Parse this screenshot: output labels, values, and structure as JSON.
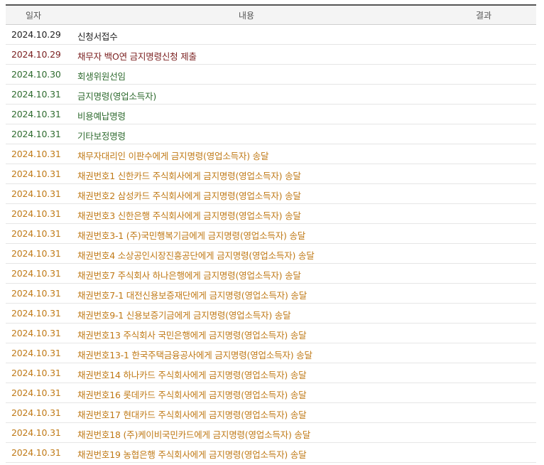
{
  "columns": {
    "date": "일자",
    "content": "내용",
    "result": "결과"
  },
  "colors": {
    "black": "#222222",
    "darkred": "#7a1f1f",
    "green": "#2f6b2f",
    "orange": "#c07a17"
  },
  "rows": [
    {
      "date": "2024.10.29",
      "content": "신청서접수",
      "result": "",
      "color": "#222222"
    },
    {
      "date": "2024.10.29",
      "content": "채무자 백O연 금지명령신청 제출",
      "result": "",
      "color": "#7a1f1f"
    },
    {
      "date": "2024.10.30",
      "content": "회생위원선임",
      "result": "",
      "color": "#2f6b2f"
    },
    {
      "date": "2024.10.31",
      "content": "금지명령(영업소득자)",
      "result": "",
      "color": "#2f6b2f"
    },
    {
      "date": "2024.10.31",
      "content": "비용예납명령",
      "result": "",
      "color": "#2f6b2f"
    },
    {
      "date": "2024.10.31",
      "content": "기타보정명령",
      "result": "",
      "color": "#2f6b2f"
    },
    {
      "date": "2024.10.31",
      "content": "채무자대리인 이판수에게 금지명령(영업소득자) 송달",
      "result": "",
      "color": "#c07a17"
    },
    {
      "date": "2024.10.31",
      "content": "채권번호1 신한카드 주식회사에게 금지명령(영업소득자) 송달",
      "result": "",
      "color": "#c07a17"
    },
    {
      "date": "2024.10.31",
      "content": "채권번호2 삼성카드 주식회사에게 금지명령(영업소득자) 송달",
      "result": "",
      "color": "#c07a17"
    },
    {
      "date": "2024.10.31",
      "content": "채권번호3 신한은행 주식회사에게 금지명령(영업소득자) 송달",
      "result": "",
      "color": "#c07a17"
    },
    {
      "date": "2024.10.31",
      "content": "채권번호3-1 (주)국민행복기금에게 금지명령(영업소득자) 송달",
      "result": "",
      "color": "#c07a17"
    },
    {
      "date": "2024.10.31",
      "content": "채권번호4 소상공인시장진흥공단에게 금지명령(영업소득자) 송달",
      "result": "",
      "color": "#c07a17"
    },
    {
      "date": "2024.10.31",
      "content": "채권번호7 주식회사 하나은행에게 금지명령(영업소득자) 송달",
      "result": "",
      "color": "#c07a17"
    },
    {
      "date": "2024.10.31",
      "content": "채권번호7-1 대전신용보증재단에게 금지명령(영업소득자) 송달",
      "result": "",
      "color": "#c07a17"
    },
    {
      "date": "2024.10.31",
      "content": "채권번호9-1 신용보증기금에게 금지명령(영업소득자) 송달",
      "result": "",
      "color": "#c07a17"
    },
    {
      "date": "2024.10.31",
      "content": "채권번호13 주식회사 국민은행에게 금지명령(영업소득자) 송달",
      "result": "",
      "color": "#c07a17"
    },
    {
      "date": "2024.10.31",
      "content": "채권번호13-1 한국주택금융공사에게 금지명령(영업소득자) 송달",
      "result": "",
      "color": "#c07a17"
    },
    {
      "date": "2024.10.31",
      "content": "채권번호14 하나카드 주식회사에게 금지명령(영업소득자) 송달",
      "result": "",
      "color": "#c07a17"
    },
    {
      "date": "2024.10.31",
      "content": "채권번호16 롯데카드 주식회사에게 금지명령(영업소득자) 송달",
      "result": "",
      "color": "#c07a17"
    },
    {
      "date": "2024.10.31",
      "content": "채권번호17 현대카드 주식회사에게 금지명령(영업소득자) 송달",
      "result": "",
      "color": "#c07a17"
    },
    {
      "date": "2024.10.31",
      "content": "채권번호18 (주)케이비국민카드에게 금지명령(영업소득자) 송달",
      "result": "",
      "color": "#c07a17"
    },
    {
      "date": "2024.10.31",
      "content": "채권번호19 농협은행 주식회사에게 금지명령(영업소득자) 송달",
      "result": "",
      "color": "#c07a17"
    }
  ]
}
